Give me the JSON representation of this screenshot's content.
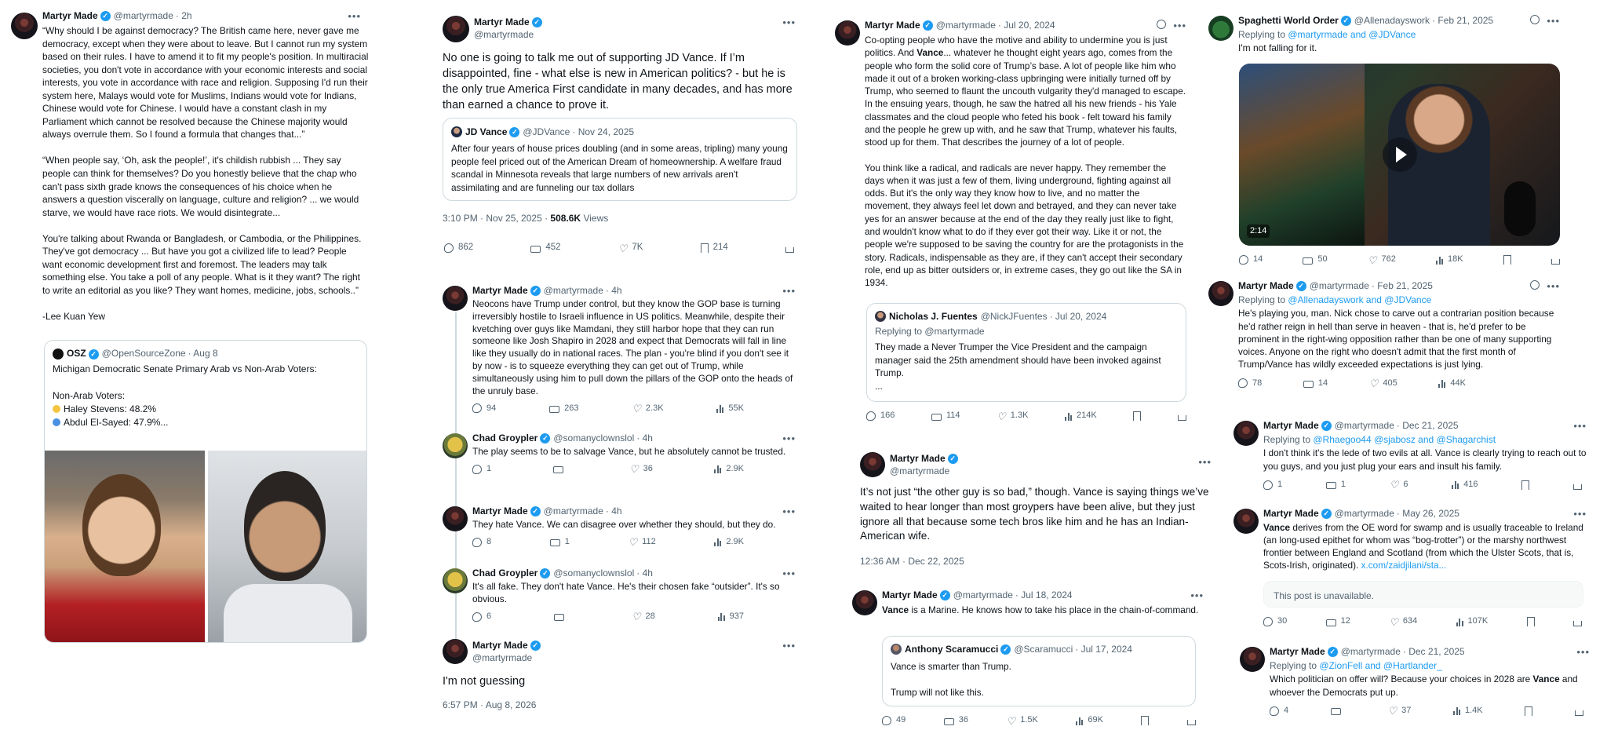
{
  "c1": {
    "name": "Martyr Made",
    "handle": "@martyrmade",
    "time": "· 2h",
    "text": "“Why should I be against democracy? The British came here, never gave me democracy, except when they were about to leave. But I cannot run my system based on their rules. I have to amend it to fit my people's position. In multiracial societies, you don't vote in accordance with your economic interests and social interests, you vote in accordance with race and religion. Supposing I'd run their system here, Malays would vote for Muslims, Indians would vote for Indians, Chinese would vote for Chinese. I would have a constant clash in my Parliament which cannot be resolved because the Chinese majority would always overrule them. So I found a formula that changes that...”\n\n“When people say, ‘Oh, ask the people!’, it's childish rubbish ... They say people can think for themselves? Do you honestly believe that the chap who can't pass sixth grade knows the consequences of his choice when he answers a question viscerally on language, culture and religion? ... we would starve, we would have race riots. We would disintegrate...\n\nYou're talking about Rwanda or Bangladesh, or Cambodia, or the Philippines. They've got democracy ... But have you got a civilized life to lead? People want economic development first and foremost. The leaders may talk something else. You take a poll of any people. What is it they want? The right to write an editorial as you like? They want homes, medicine, jobs, schools..”\n\n-Lee Kuan Yew",
    "quote": {
      "name": "OSZ",
      "handle": "@OpenSourceZone",
      "time": "· Aug 8",
      "title": "Michigan Democratic Senate Primary Arab vs Non-Arab Voters:",
      "subtitle": "Non-Arab Voters:",
      "line1": "Haley Stevens: 48.2%",
      "line2": "Abdul El-Sayed: 47.9%...",
      "dot1": "#f5c542",
      "dot2": "#4a90e2"
    }
  },
  "c2": {
    "main": {
      "name": "Martyr Made",
      "handle": "@martyrmade",
      "text": "No one is going to talk me out of supporting JD Vance. If I’m disappointed, fine - what else is new in American politics? - but he is the only true America First candidate in many decades, and has more than earned a chance to prove it.",
      "quote": {
        "name": "JD Vance",
        "handle": "@JDVance",
        "time": "· Nov 24, 2025",
        "text": "After four years of house prices doubling (and in some areas, tripling) many young people feel priced out of the American Dream of homeownership. A welfare fraud scandal in Minnesota reveals that large numbers of new arrivals aren't assimilating and are funneling our tax dollars"
      },
      "time": "3:10 PM · Nov 25, 2025 · ",
      "views": "508.6K",
      "views_label": " Views",
      "replies": "862",
      "reposts": "452",
      "likes": "7K",
      "bookmarks": "214"
    },
    "r1": {
      "name": "Martyr Made",
      "handle": "@martyrmade",
      "time": "· 4h",
      "text": "Neocons have Trump under control, but they know the GOP base is turning irreversibly hostile to Israeli influence in US politics. Meanwhile, despite their kvetching over guys like Mamdani, they still harbor hope that they can run someone like Josh Shapiro in 2028 and expect that Democrats will fall in line like they usually do in national races. The plan - you're blind if you don't see it by now - is to squeeze everything they can get out of Trump, while simultaneously using him to pull down the pillars of the GOP onto the heads of the unruly base.",
      "replies": "94",
      "reposts": "263",
      "likes": "2.3K",
      "views": "55K"
    },
    "r2": {
      "name": "Chad Groypler",
      "handle": "@somanyclownslol",
      "time": "· 4h",
      "text": "The play seems to be to salvage Vance, but he absolutely cannot be trusted.",
      "replies": "1",
      "reposts": "",
      "likes": "36",
      "views": "2.9K"
    },
    "r3": {
      "name": "Martyr Made",
      "handle": "@martyrmade",
      "time": "· 4h",
      "text": "They hate Vance. We can disagree over whether they should, but they do.",
      "replies": "8",
      "reposts": "1",
      "likes": "112",
      "views": "2.9K"
    },
    "r4": {
      "name": "Chad Groypler",
      "handle": "@somanyclownslol",
      "time": "· 4h",
      "text": "It's all fake. They don't hate Vance. He's their chosen fake “outsider”. It's so obvious.",
      "replies": "6",
      "reposts": "",
      "likes": "28",
      "views": "937"
    },
    "r5": {
      "name": "Martyr Made",
      "handle": "@martyrmade",
      "text": "I'm not guessing",
      "time": "6:57 PM · Aug 8, 2026"
    }
  },
  "c3": {
    "p1": {
      "name": "Martyr Made",
      "handle": "@martyrmade",
      "time": "· Jul 20, 2024",
      "text_a": "Co-opting people who have the motive and ability to undermine you is just politics. And ",
      "bold": "Vance",
      "text_b": "... whatever he thought eight years ago, comes from the people who form the solid core of Trump’s base. A lot of people like him who made it out of a broken working-class upbringing were initially turned off by Trump, who seemed to flaunt the uncouth vulgarity they'd managed to escape. In the ensuing years, though, he saw the hatred all his new friends - his Yale classmates and the cloud people who feted his book - felt toward his family and the people he grew up with, and he saw that Trump, whatever his faults, stood up for them. That describes the journey of a lot of people.\n\nYou think like a radical, and radicals are never happy. They remember the days when it was just a few of them, living underground, fighting against all odds. But it's the only way they know how to live, and no matter the movement, they always feel let down and betrayed, and they can never take yes for an answer because at the end of the day they really just like to fight, and wouldn't know what to do if they ever got their way. Like it or not, the people we're supposed to be saving the country for are the protagonists in the story. Radicals, indispensable as they are, if they can't accept their secondary role, end up as bitter outsiders or, in extreme cases, they go out like the SA in 1934.",
      "quote": {
        "name": "Nicholas J. Fuentes",
        "handle": "@NickJFuentes",
        "time": "· Jul 20, 2024",
        "replying": "Replying to @martyrmade",
        "text": "They made a Never Trumper the Vice President and the campaign manager said the 25th amendment should have been invoked against Trump.\n..."
      },
      "replies": "166",
      "reposts": "114",
      "likes": "1.3K",
      "views": "214K"
    },
    "p2": {
      "name": "Martyr Made",
      "handle": "@martyrmade",
      "text": "It’s not just “the other guy is so bad,” though. Vance is saying things we’ve waited to hear longer than most groypers have been alive, but they just ignore all that because some tech bros like him and he has an Indian-American wife.",
      "time": "12:36 AM · Dec 22, 2025"
    },
    "p3": {
      "name": "Martyr Made",
      "handle": "@martyrmade",
      "time": "· Jul 18, 2024",
      "bold": "Vance",
      "text": " is a Marine. He knows how to take his place in the chain-of-command.",
      "quote": {
        "name": "Anthony Scaramucci",
        "handle": "@Scaramucci",
        "time": "· Jul 17, 2024",
        "text": "Vance is smarter than Trump.\n\nTrump will not like this."
      },
      "replies": "49",
      "reposts": "36",
      "likes": "1.5K",
      "views": "69K"
    }
  },
  "c4": {
    "p1": {
      "name": "Spaghetti World Order",
      "handle": "@Allenadayswork",
      "time": "· Feb 21, 2025",
      "replying": "Replying to ",
      "replying_to": "@martyrmade and @JDVance",
      "text": "I'm not falling for it.",
      "duration": "2:14",
      "replies": "14",
      "reposts": "50",
      "likes": "762",
      "views": "18K"
    },
    "p2": {
      "name": "Martyr Made",
      "handle": "@martyrmade",
      "time": "· Feb 21, 2025",
      "replying": "Replying to ",
      "replying_to": "@Allenadayswork and @JDVance",
      "text": "He's playing you, man. Nick chose to carve out a contrarian position because he'd rather reign in hell than serve in heaven - that is, he'd prefer to be prominent in the right-wing opposition rather than be one of many supporting voices. Anyone on the right who doesn't admit that the first month of Trump/Vance has wildly exceeded expectations is just lying.",
      "replies": "78",
      "reposts": "14",
      "likes": "405",
      "views": "44K"
    },
    "p3": {
      "name": "Martyr Made",
      "handle": "@martyrmade",
      "time": "· Dec 21, 2025",
      "replying": "Replying to ",
      "replying_to": "@Rhaegoo44 @sjabosz and @Shagarchist",
      "text": "I don't think it's the lede of two evils at all. Vance is clearly trying to reach out to you guys, and you just plug your ears and insult his family.",
      "replies": "1",
      "reposts": "1",
      "likes": "6",
      "views": "416"
    },
    "p4": {
      "name": "Martyr Made",
      "handle": "@martyrmade",
      "time": "· May 26, 2025",
      "bold": "Vance",
      "text": " derives from the OE word for swamp and is usually traceable to Ireland (an long-used epithet for whom was “bog-trotter”) or the marshy northwest frontier between England and Scotland (from which the Ulster Scots, that is, Scots-Irish, originated). ",
      "link": "x.com/zaidjilani/sta...",
      "unavailable": "This post is unavailable.",
      "replies": "30",
      "reposts": "12",
      "likes": "634",
      "views": "107K"
    },
    "p5": {
      "name": "Martyr Made",
      "handle": "@martyrmade",
      "time": "· Dec 21, 2025",
      "replying": "Replying to ",
      "replying_to": "@ZionFell and @Hartlander_",
      "text_a": "Which politician on offer will? Because your choices in 2028 are ",
      "bold": "Vance",
      "text_b": " and whoever the Democrats put up.",
      "replies": "4",
      "reposts": "",
      "likes": "37",
      "views": "1.4K"
    }
  },
  "icons": {
    "more": "more-dots-icon",
    "verified": "verified-badge-icon",
    "reply": "reply-icon",
    "repost": "repost-icon",
    "like": "heart-icon",
    "views": "views-icon",
    "bookmark": "bookmark-icon",
    "share": "share-icon",
    "grok": "grok-icon",
    "play": "play-icon"
  },
  "colors": {
    "accent": "#1d9bf0",
    "text": "#0f1419",
    "muted": "#536471",
    "border": "#cfd9de"
  }
}
